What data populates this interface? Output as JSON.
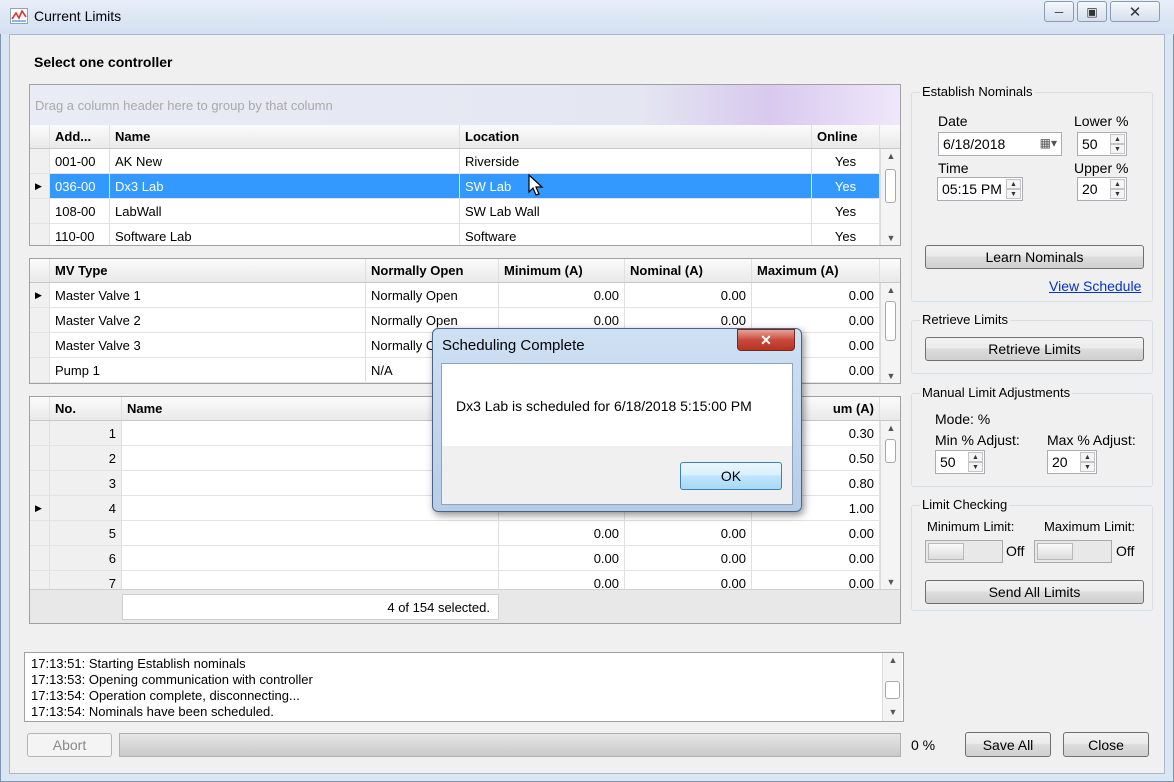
{
  "window": {
    "title": "Current Limits"
  },
  "controller_section": {
    "label": "Select one controller",
    "group_hint": "Drag a column header here to group by that column"
  },
  "controllers": {
    "columns": [
      "Add...",
      "Name",
      "Location",
      "Online"
    ],
    "rows": [
      {
        "address": "001-00",
        "name": "AK New",
        "location": "Riverside",
        "online": "Yes",
        "selected": false
      },
      {
        "address": "036-00",
        "name": "Dx3 Lab",
        "location": "SW Lab",
        "online": "Yes",
        "selected": true
      },
      {
        "address": "108-00",
        "name": "LabWall",
        "location": "SW Lab Wall",
        "online": "Yes",
        "selected": false
      },
      {
        "address": "110-00",
        "name": "Software Lab",
        "location": "Software",
        "online": "Yes",
        "selected": false
      }
    ]
  },
  "mv_grid": {
    "columns": [
      "MV Type",
      "Normally Open",
      "Minimum (A)",
      "Nominal (A)",
      "Maximum (A)"
    ],
    "rows": [
      {
        "type": "Master Valve 1",
        "normally_open": "Normally Open",
        "min": "0.00",
        "nominal": "0.00",
        "max": "0.00"
      },
      {
        "type": "Master Valve 2",
        "normally_open": "Normally Open",
        "min": "0.00",
        "nominal": "0.00",
        "max": "0.00"
      },
      {
        "type": "Master Valve 3",
        "normally_open": "Normally O",
        "min": "",
        "nominal": "",
        "max": "0.00"
      },
      {
        "type": "Pump 1",
        "normally_open": "N/A",
        "min": "",
        "nominal": "",
        "max": "0.00"
      }
    ]
  },
  "station_grid": {
    "columns": [
      "No.",
      "Name",
      "um (A)"
    ],
    "rows": [
      {
        "no": "1",
        "min": "",
        "nominal": "",
        "max": "0.30"
      },
      {
        "no": "2",
        "min": "",
        "nominal": "",
        "max": "0.50"
      },
      {
        "no": "3",
        "min": "",
        "nominal": "",
        "max": "0.80"
      },
      {
        "no": "4",
        "min": "",
        "nominal": "",
        "max": "1.00"
      },
      {
        "no": "5",
        "min": "0.00",
        "nominal": "0.00",
        "max": "0.00"
      },
      {
        "no": "6",
        "min": "0.00",
        "nominal": "0.00",
        "max": "0.00"
      },
      {
        "no": "7",
        "min": "0.00",
        "nominal": "0.00",
        "max": "0.00"
      }
    ],
    "footer": "4 of 154 selected."
  },
  "nominals": {
    "title": "Establish Nominals",
    "date_label": "Date",
    "date_value": "6/18/2018",
    "lower_label": "Lower %",
    "lower_value": "50",
    "time_label": "Time",
    "time_value": "05:15 PM",
    "upper_label": "Upper %",
    "upper_value": "20",
    "learn_button": "Learn Nominals",
    "view_schedule_link": "View Schedule"
  },
  "retrieve": {
    "title": "Retrieve Limits",
    "button": "Retrieve Limits"
  },
  "manual": {
    "title": "Manual Limit Adjustments",
    "mode": "Mode: %",
    "min_label": "Min % Adjust:",
    "min_value": "50",
    "max_label": "Max % Adjust:",
    "max_value": "20"
  },
  "limit_checking": {
    "title": "Limit Checking",
    "min_label": "Minimum Limit:",
    "min_state": "Off",
    "max_label": "Maximum Limit:",
    "max_state": "Off",
    "send_button": "Send All Limits"
  },
  "log": [
    "17:13:51: Starting Establish nominals",
    "17:13:53: Opening communication with controller",
    "17:13:54: Operation complete, disconnecting...",
    "17:13:54: Nominals have been scheduled."
  ],
  "bottom": {
    "abort": "Abort",
    "progress_percent": "0 %",
    "progress_value": 0,
    "save_all": "Save All",
    "close": "Close"
  },
  "dialog": {
    "title": "Scheduling Complete",
    "message": "Dx3 Lab is scheduled for 6/18/2018 5:15:00 PM",
    "ok": "OK"
  }
}
